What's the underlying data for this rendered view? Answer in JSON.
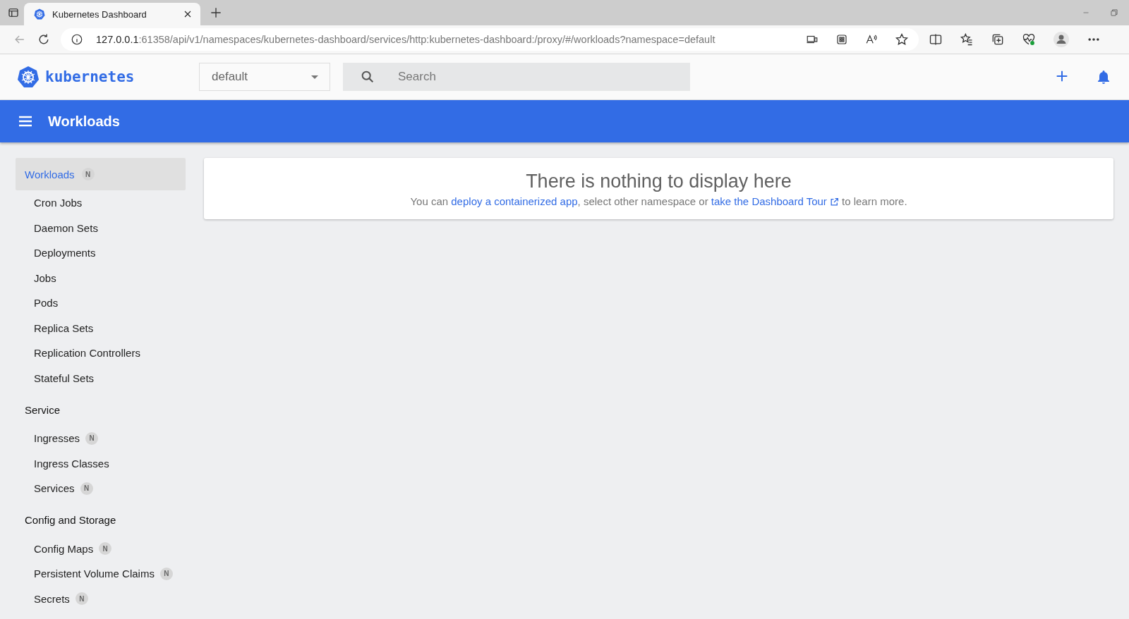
{
  "browser": {
    "tabs": [
      {
        "title": "Kubernetes Dashboard",
        "selected": true
      }
    ],
    "url_host": "127.0.0.1",
    "url_rest": ":61358/api/v1/namespaces/kubernetes-dashboard/services/http:kubernetes-dashboard:/proxy/#/workloads?namespace=default"
  },
  "header": {
    "logo_text": "kubernetes",
    "namespace": "default",
    "search_placeholder": "Search"
  },
  "toolbar": {
    "title": "Workloads"
  },
  "sidebar": [
    {
      "label": "Workloads",
      "selected": true,
      "badge": "N",
      "children": [
        {
          "label": "Cron Jobs",
          "selected": false
        },
        {
          "label": "Daemon Sets",
          "selected": false
        },
        {
          "label": "Deployments",
          "selected": false
        },
        {
          "label": "Jobs",
          "selected": false
        },
        {
          "label": "Pods",
          "selected": false
        },
        {
          "label": "Replica Sets",
          "selected": false
        },
        {
          "label": "Replication Controllers",
          "selected": false
        },
        {
          "label": "Stateful Sets",
          "selected": false
        }
      ]
    },
    {
      "label": "Service",
      "selected": false,
      "children": [
        {
          "label": "Ingresses",
          "selected": false,
          "badge": "N"
        },
        {
          "label": "Ingress Classes",
          "selected": false
        },
        {
          "label": "Services",
          "selected": false,
          "badge": "N"
        }
      ]
    },
    {
      "label": "Config and Storage",
      "selected": false,
      "children": [
        {
          "label": "Config Maps",
          "selected": false,
          "badge": "N"
        },
        {
          "label": "Persistent Volume Claims",
          "selected": false,
          "badge": "N"
        },
        {
          "label": "Secrets",
          "selected": false,
          "badge": "N"
        }
      ]
    }
  ],
  "empty_state": {
    "title": "There is nothing to display here",
    "parts": [
      {
        "kind": "text",
        "text": "You can "
      },
      {
        "kind": "link",
        "text": "deploy a containerized app",
        "external": false
      },
      {
        "kind": "text",
        "text": ", select other namespace or "
      },
      {
        "kind": "link",
        "text": "take the Dashboard Tour",
        "external": true
      },
      {
        "kind": "text",
        "text": " to learn more."
      }
    ]
  }
}
